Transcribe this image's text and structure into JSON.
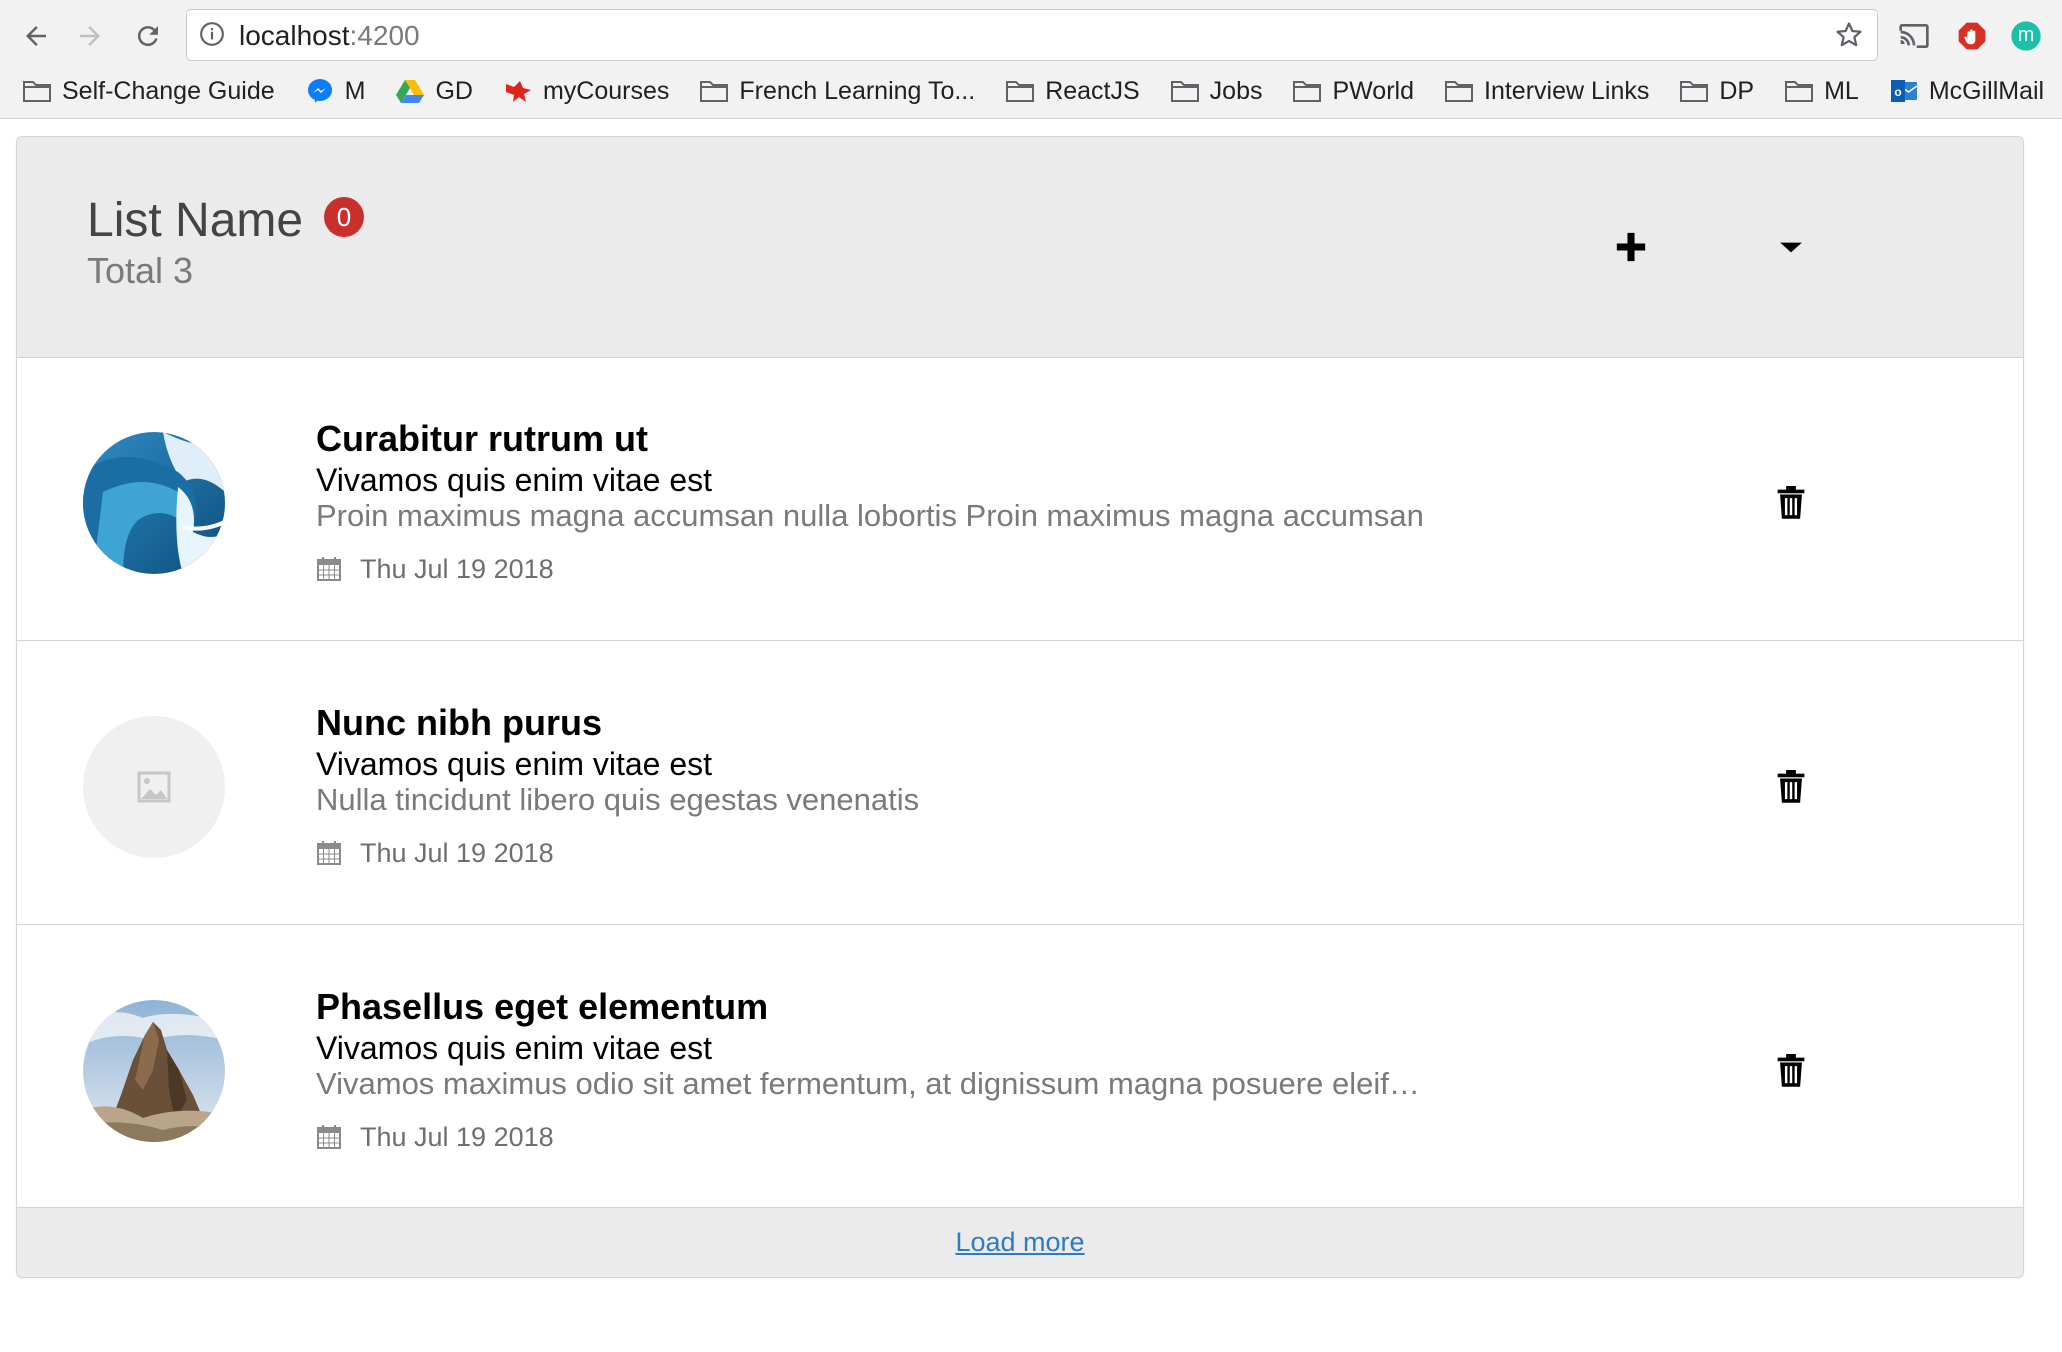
{
  "browser": {
    "url_host": "localhost",
    "url_port": ":4200",
    "bookmarks": [
      {
        "label": "Self-Change Guide",
        "icon": "folder-icon"
      },
      {
        "label": "M",
        "icon": "messenger-icon"
      },
      {
        "label": "GD",
        "icon": "google-drive-icon"
      },
      {
        "label": "myCourses",
        "icon": "mycourses-icon"
      },
      {
        "label": "French Learning To...",
        "icon": "folder-icon"
      },
      {
        "label": "ReactJS",
        "icon": "folder-icon"
      },
      {
        "label": "Jobs",
        "icon": "folder-icon"
      },
      {
        "label": "PWorld",
        "icon": "folder-icon"
      },
      {
        "label": "Interview Links",
        "icon": "folder-icon"
      },
      {
        "label": "DP",
        "icon": "folder-icon"
      },
      {
        "label": "ML",
        "icon": "folder-icon"
      },
      {
        "label": "McGillMail",
        "icon": "outlook-icon"
      }
    ],
    "profile_initial": "m"
  },
  "list": {
    "name": "List Name",
    "badge_count": "0",
    "total_label": "Total 3",
    "add_icon": "plus-icon",
    "dropdown_icon": "caret-down-icon",
    "items": [
      {
        "title": "Curabitur rutrum ut",
        "subtitle": "Vivamos quis enim vitae est",
        "description": "Proin  maximus  magna  accumsan  nulla  lobortis  Proin  maximus  magna  accumsan",
        "date": "Thu Jul 19 2018",
        "image": "wave-photo"
      },
      {
        "title": "Nunc nibh purus",
        "subtitle": "Vivamos quis enim vitae est",
        "description": "Nulla tincidunt libero quis egestas venenatis",
        "date": "Thu Jul 19 2018",
        "image": "placeholder-image"
      },
      {
        "title": "Phasellus eget elementum",
        "subtitle": "Vivamos quis enim vitae est",
        "description": "Vivamos maximus odio sit amet fermentum, at dignissum magna posuere eleifend",
        "date": "Thu Jul 19 2018",
        "image": "mountain-photo"
      }
    ],
    "load_more_label": "Load more"
  },
  "colors": {
    "badge": "#c9302c",
    "header_bg": "#ebebeb",
    "link": "#2f7bbf"
  }
}
